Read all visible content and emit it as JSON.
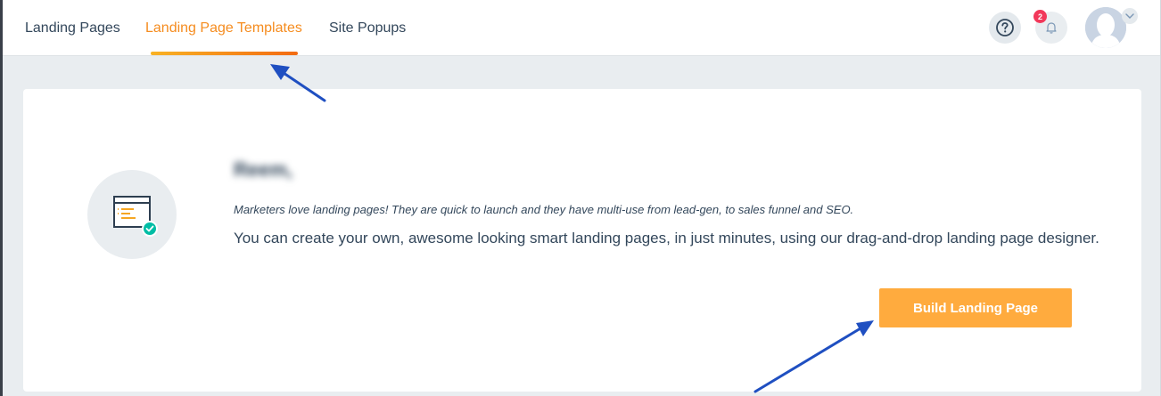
{
  "nav": {
    "tabs": [
      {
        "label": "Landing Pages",
        "active": false
      },
      {
        "label": "Landing Page Templates",
        "active": true
      },
      {
        "label": "Site Popups",
        "active": false
      }
    ],
    "notification_count": "2",
    "icons": {
      "help": "question-circle-icon",
      "notifications": "bell-icon",
      "avatar": "user-avatar",
      "menu": "chevron-down-icon"
    }
  },
  "card": {
    "greeting": "Reem,",
    "tagline": "Marketers love landing pages! They are quick to launch and they have multi-use from lead-gen, to sales funnel and SEO.",
    "description": "You can create your own, awesome looking smart landing pages, in just minutes, using our drag-and-drop landing page designer.",
    "cta_label": "Build Landing Page",
    "illustration_icon": "landing-page-check-icon"
  },
  "colors": {
    "accent": "#f58c1f",
    "cta": "#ffab3e",
    "text": "#33475b",
    "badge": "#f2385a",
    "annotation_arrow": "#1f4fc1"
  }
}
